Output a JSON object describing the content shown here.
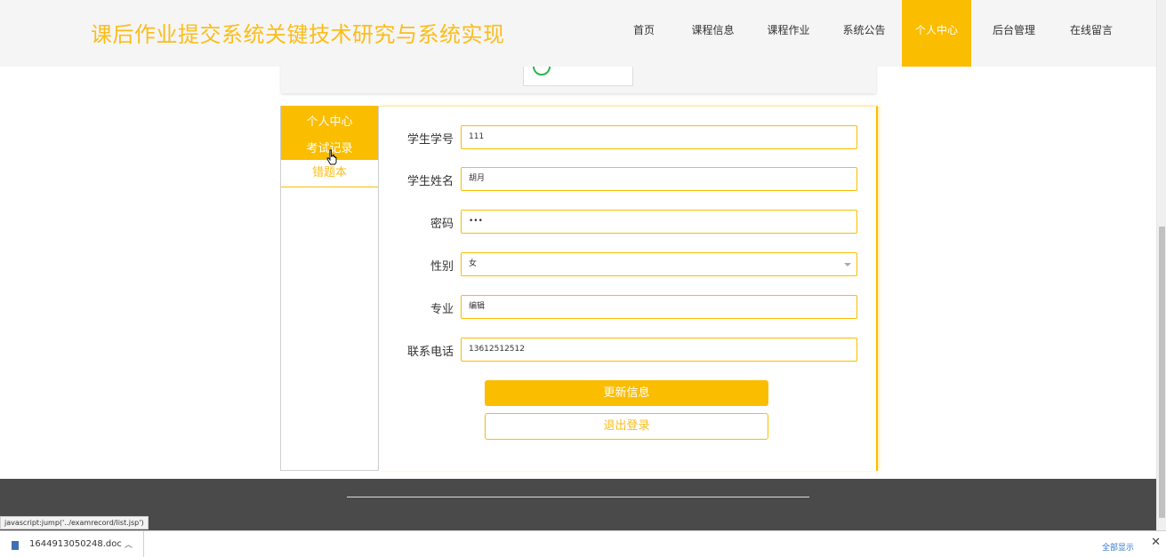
{
  "header": {
    "title": "课后作业提交系统关键技术研究与系统实现",
    "nav": [
      "首页",
      "课程信息",
      "课程作业",
      "系统公告",
      "个人中心",
      "后台管理",
      "在线留言"
    ],
    "active_index": 4
  },
  "sidebar": {
    "title": "个人中心",
    "items": [
      "考试记录",
      "错题本"
    ]
  },
  "form": {
    "fields": [
      {
        "label": "学生学号",
        "value": "111"
      },
      {
        "label": "学生姓名",
        "value": "胡月"
      },
      {
        "label": "密码",
        "value": "•••"
      },
      {
        "label": "性别",
        "value": "女"
      },
      {
        "label": "专业",
        "value": "编辑"
      },
      {
        "label": "联系电话",
        "value": "13612512512"
      }
    ],
    "update_button": "更新信息",
    "logout_button": "退出登录"
  },
  "status_url": "javascript:jump('../examrecord/list.jsp')",
  "downloads": {
    "file_name": "1644913050248.doc",
    "show_all": "全部显示",
    "close_glyph": "✕"
  },
  "colors": {
    "accent": "#fbbd00",
    "title_color": "#fbbd18",
    "footer_bg": "#4a4a4a"
  },
  "icons": [
    "cursor-hand-icon",
    "doc-file-icon",
    "chevron-up-icon",
    "close-icon",
    "caret-down-icon"
  ]
}
